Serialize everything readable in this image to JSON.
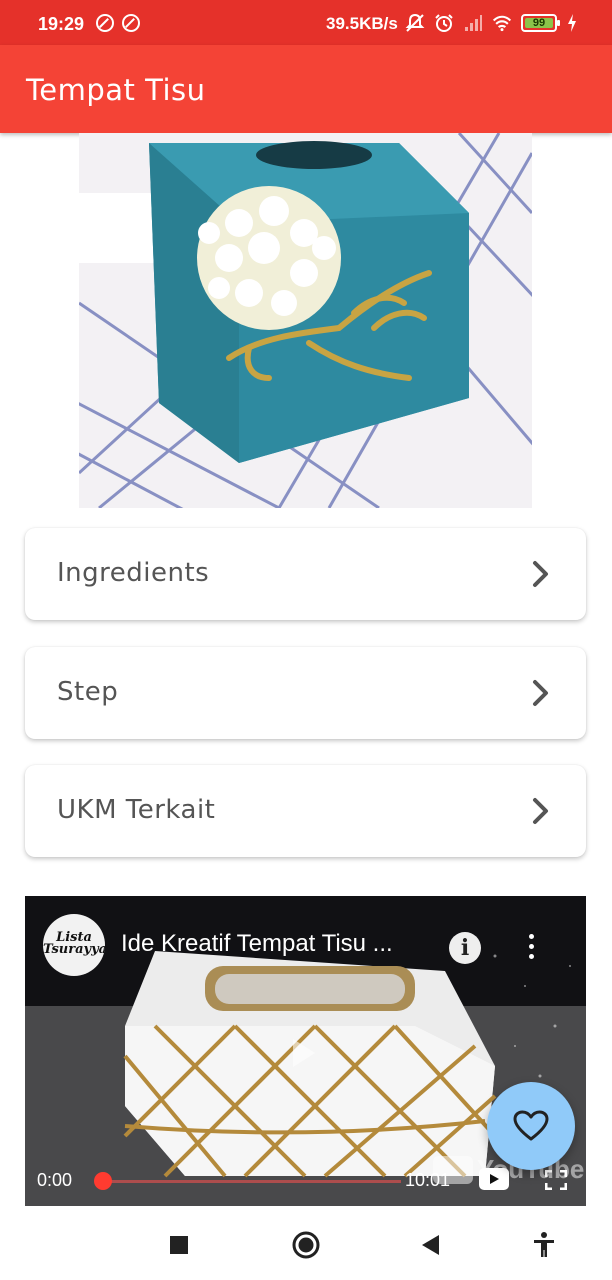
{
  "status_bar": {
    "time": "19:29",
    "speed": "39.5KB/s",
    "battery": "99",
    "icons": [
      "do-not-disturb-icon",
      "do-not-disturb-icon",
      "mute-icon",
      "alarm-icon",
      "signal-icon",
      "wifi-icon",
      "battery-icon",
      "charging-icon"
    ]
  },
  "app_bar": {
    "title": "Tempat Tisu"
  },
  "hero": {
    "alt": "Blue felt tissue box with white flower decoration"
  },
  "menu": {
    "items": [
      {
        "label": "Ingredients"
      },
      {
        "label": "Step"
      },
      {
        "label": "UKM Terkait"
      }
    ]
  },
  "video": {
    "channel": "Lista Tsurayya",
    "title": "Ide Kreatif Tempat Tisu ...",
    "info_glyph": "i",
    "current_time": "0:00",
    "duration": "10:01",
    "progress": 0,
    "watermark": "YouTube"
  },
  "fab": {
    "icon": "heart-outline-icon"
  },
  "nav": {
    "icons": [
      "recents-square-icon",
      "home-circle-icon",
      "back-triangle-icon",
      "accessibility-icon"
    ]
  },
  "colors": {
    "status_bar": "#e5312a",
    "app_bar": "#f44336",
    "fab": "#90caf9",
    "text_secondary": "#555555"
  }
}
